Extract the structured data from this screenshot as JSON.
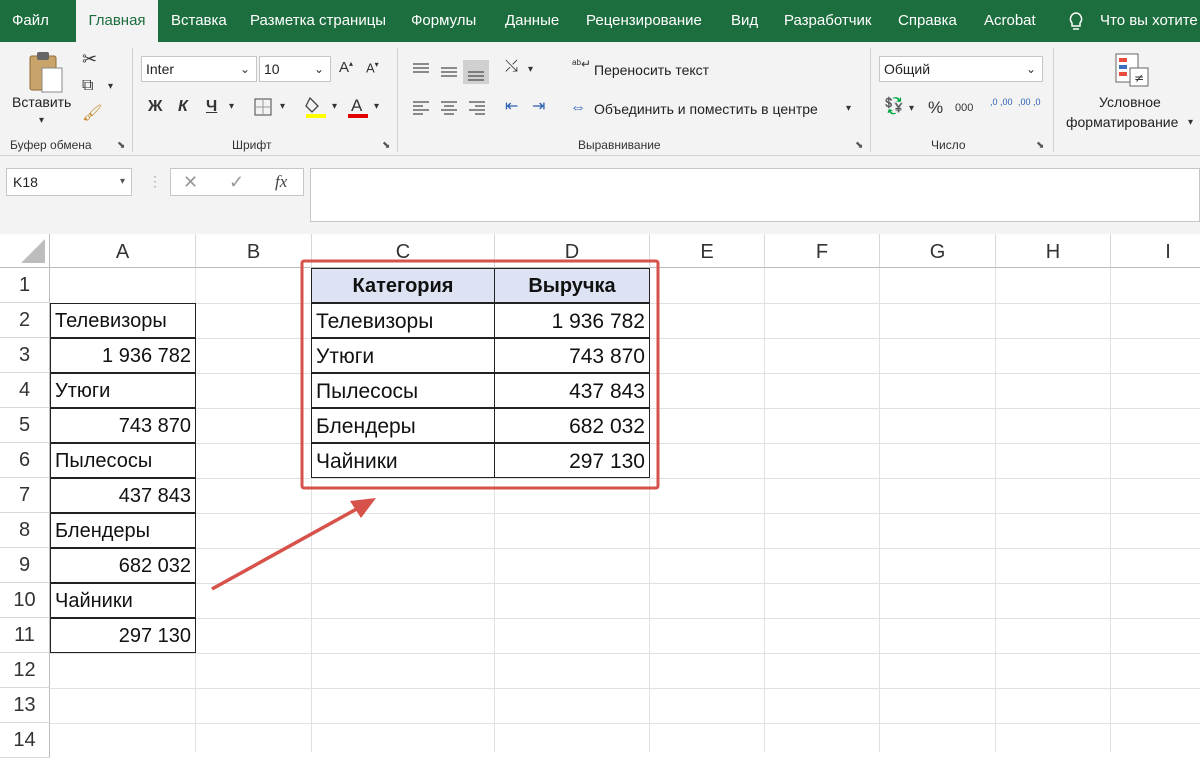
{
  "menu": {
    "tabs": [
      "Файл",
      "Главная",
      "Вставка",
      "Разметка страницы",
      "Формулы",
      "Данные",
      "Рецензирование",
      "Вид",
      "Разработчик",
      "Справка",
      "Acrobat"
    ],
    "active_tab": "Главная",
    "tell_me": "Что вы хотите"
  },
  "ribbon": {
    "clipboard": {
      "paste_label": "Вставить",
      "group_label": "Буфер обмена"
    },
    "font": {
      "font_name": "Inter",
      "font_size": "10",
      "bold": "Ж",
      "italic": "К",
      "underline": "Ч",
      "group_label": "Шрифт"
    },
    "alignment": {
      "wrap_text": "Переносить текст",
      "merge_center": "Объединить и поместить в центре",
      "group_label": "Выравнивание"
    },
    "number": {
      "format": "Общий",
      "percent": "%",
      "thousands": "000",
      "dec_inc": ",0 ,00",
      "dec_dec": ",00 ,0",
      "group_label": "Число"
    },
    "styles": {
      "conditional_line1": "Условное",
      "conditional_line2": "форматирование"
    }
  },
  "formula_bar": {
    "name_box": "K18",
    "fx": "fx",
    "formula": ""
  },
  "sheet": {
    "columns": [
      "A",
      "B",
      "C",
      "D",
      "E",
      "F",
      "G",
      "H",
      "I"
    ],
    "rows": [
      "1",
      "2",
      "3",
      "4",
      "5",
      "6",
      "7",
      "8",
      "9",
      "10",
      "11",
      "12",
      "13",
      "14"
    ],
    "column_a": [
      {
        "row": 2,
        "text": "Телевизоры",
        "align": "left"
      },
      {
        "row": 3,
        "text": "1 936 782",
        "align": "right"
      },
      {
        "row": 4,
        "text": "Утюги",
        "align": "left"
      },
      {
        "row": 5,
        "text": "743 870",
        "align": "right"
      },
      {
        "row": 6,
        "text": "Пылесосы",
        "align": "left"
      },
      {
        "row": 7,
        "text": "437 843",
        "align": "right"
      },
      {
        "row": 8,
        "text": "Блендеры",
        "align": "left"
      },
      {
        "row": 9,
        "text": "682 032",
        "align": "right"
      },
      {
        "row": 10,
        "text": "Чайники",
        "align": "left"
      },
      {
        "row": 11,
        "text": "297 130",
        "align": "right"
      }
    ],
    "table": {
      "headers": [
        "Категория",
        "Выручка"
      ],
      "rows": [
        [
          "Телевизоры",
          "1 936 782"
        ],
        [
          "Утюги",
          "743 870"
        ],
        [
          "Пылесосы",
          "437 843"
        ],
        [
          "Блендеры",
          "682 032"
        ],
        [
          "Чайники",
          "297 130"
        ]
      ]
    }
  },
  "colors": {
    "excel_green": "#1d6e3f",
    "header_fill": "#dde3f2",
    "annotation_red": "#d6524a"
  }
}
